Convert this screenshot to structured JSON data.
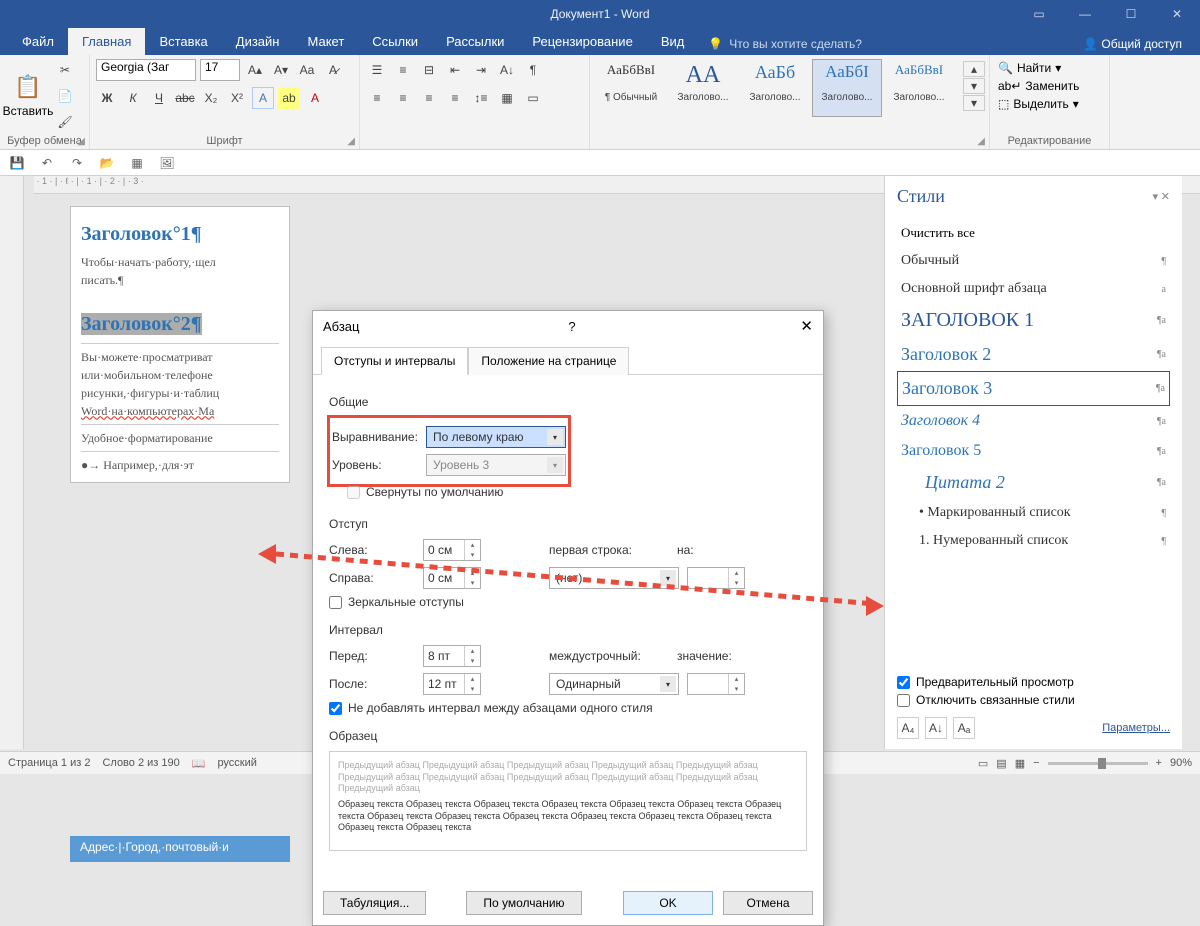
{
  "title_bar": {
    "doc_title": "Документ1 - Word"
  },
  "tabs": {
    "items": [
      "Файл",
      "Главная",
      "Вставка",
      "Дизайн",
      "Макет",
      "Ссылки",
      "Рассылки",
      "Рецензирование",
      "Вид"
    ],
    "active": 1,
    "tellme": "Что вы хотите сделать?",
    "share": "Общий доступ"
  },
  "ribbon": {
    "clipboard": {
      "paste": "Вставить",
      "label": "Буфер обмена"
    },
    "font": {
      "family": "Georgia (Заг",
      "size": "17",
      "bold": "Ж",
      "italic": "К",
      "underline": "Ч",
      "strike": "abc",
      "label": "Шрифт"
    },
    "styles": [
      {
        "sample": "АаБбВвI",
        "label": "¶ Обычный"
      },
      {
        "sample": "АА",
        "label": "Заголово..."
      },
      {
        "sample": "АаБб",
        "label": "Заголово..."
      },
      {
        "sample": "АаБбI",
        "label": "Заголово..."
      },
      {
        "sample": "АаБбВвI",
        "label": "Заголово..."
      }
    ],
    "styles_selected": 3,
    "editing": {
      "find": "Найти",
      "replace": "Заменить",
      "select": "Выделить",
      "label": "Редактирование"
    }
  },
  "document": {
    "h1": "Заголовок°1¶",
    "p1": "Чтобы·начать·работу,·щел",
    "p1b": "писать.¶",
    "h2": "Заголовок°2¶",
    "p2": "Вы·можете·просматриват",
    "p3": "или·мобильном·телефоне",
    "p4": "рисунки,·фигуры·и·таблиц",
    "p5": "Word·на·компьютерах·Ma",
    "p6": "Удобное·форматирование",
    "p7": "●→ Например,·для·эт",
    "addr": "Адрес·|·Город,·почтовый·и"
  },
  "dialog": {
    "title": "Абзац",
    "tab1": "Отступы и интервалы",
    "tab2": "Положение на странице",
    "general": "Общие",
    "align_lbl": "Выравнивание:",
    "align_val": "По левому краю",
    "level_lbl": "Уровень:",
    "level_val": "Уровень 3",
    "collapse": "Свернуты по умолчанию",
    "indent": "Отступ",
    "left_lbl": "Слева:",
    "left_val": "0 см",
    "right_lbl": "Справа:",
    "right_val": "0 см",
    "first_lbl": "первая строка:",
    "first_val": "(нет)",
    "by_lbl": "на:",
    "mirror": "Зеркальные отступы",
    "spacing": "Интервал",
    "before_lbl": "Перед:",
    "before_val": "8 пт",
    "after_lbl": "После:",
    "after_val": "12 пт",
    "line_lbl": "междустрочный:",
    "line_val": "Одинарный",
    "val_lbl": "значение:",
    "nosame": "Не добавлять интервал между абзацами одного стиля",
    "sample": "Образец",
    "preview_prev": "Предыдущий абзац Предыдущий абзац Предыдущий абзац Предыдущий абзац Предыдущий абзац Предыдущий абзац Предыдущий абзац Предыдущий абзац Предыдущий абзац Предыдущий абзац Предыдущий абзац",
    "preview_sample": "Образец текста Образец текста Образец текста Образец текста Образец текста Образец текста Образец текста Образец текста Образец текста Образец текста Образец текста Образец текста Образец текста Образец текста Образец текста",
    "tabs_btn": "Табуляция...",
    "default_btn": "По умолчанию",
    "ok": "OK",
    "cancel": "Отмена"
  },
  "styles_pane": {
    "title": "Стили",
    "clear": "Очистить все",
    "entries": [
      {
        "t": "Обычный",
        "css": "font-size:14px;color:#333",
        "m": "¶"
      },
      {
        "t": "Основной шрифт абзаца",
        "css": "font-family:Georgia;font-size:14px;color:#333",
        "m": "a"
      },
      {
        "t": "ЗАГОЛОВОК 1",
        "css": "font-family:Georgia;font-size:20px;color:#2b579a",
        "m": "¶a"
      },
      {
        "t": "Заголовок 2",
        "css": "font-family:Georgia;font-size:18px;color:#2e74b5",
        "m": "¶a"
      },
      {
        "t": "Заголовок 3",
        "css": "font-family:Georgia;font-size:18px;color:#2e74b5",
        "m": "¶a"
      },
      {
        "t": "Заголовок 4",
        "css": "font-family:Georgia;font-style:italic;font-size:16px;color:#2e74b5",
        "m": "¶a"
      },
      {
        "t": "Заголовок 5",
        "css": "font-family:Georgia;font-size:16px;color:#2e74b5",
        "m": "¶a"
      },
      {
        "t": "Цитата 2",
        "css": "font-family:Georgia;font-style:italic;font-size:18px;color:#2e74b5;padding-left:24px",
        "m": "¶a"
      },
      {
        "t": "•  Маркированный список",
        "css": "font-size:14px;color:#333;padding-left:18px",
        "m": "¶"
      },
      {
        "t": "1.  Нумерованный список",
        "css": "font-size:14px;color:#333;padding-left:18px",
        "m": "¶"
      }
    ],
    "selected": 4,
    "preview_chk": "Предварительный просмотр",
    "disable_chk": "Отключить связанные стили",
    "params": "Параметры..."
  },
  "status": {
    "page": "Страница 1 из 2",
    "words": "Слово 2 из 190",
    "lang": "русский",
    "zoom": "90%"
  }
}
